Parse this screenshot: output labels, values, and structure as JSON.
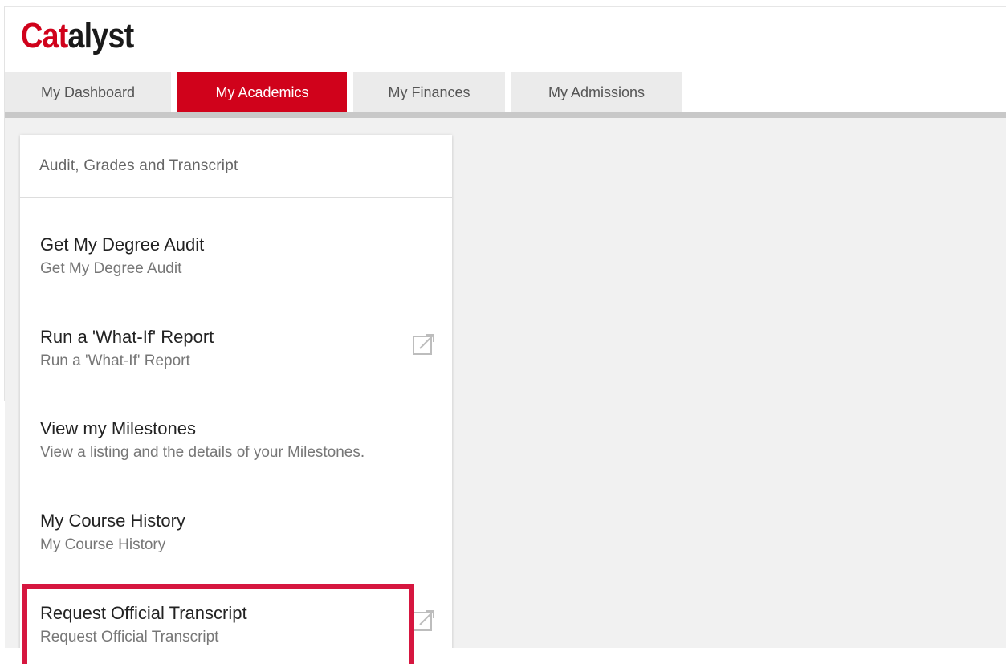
{
  "app": {
    "logo_part1": "Cat",
    "logo_part2": "alyst"
  },
  "tabs": [
    {
      "label": "My Dashboard",
      "active": false
    },
    {
      "label": "My Academics",
      "active": true
    },
    {
      "label": "My Finances",
      "active": false
    },
    {
      "label": "My Admissions",
      "active": false
    }
  ],
  "card": {
    "title": "Audit, Grades and Transcript",
    "items": [
      {
        "title": "Get My Degree Audit",
        "subtitle": "Get My Degree Audit",
        "icon": "none"
      },
      {
        "title": "Run a 'What-If' Report",
        "subtitle": "Run a 'What-If' Report",
        "icon": "external-link-icon"
      },
      {
        "title": "View my Milestones",
        "subtitle": "View a listing and the details of your Milestones.",
        "icon": "none"
      },
      {
        "title": "My Course History",
        "subtitle": "My Course History",
        "icon": "none"
      },
      {
        "title": "Request Official Transcript",
        "subtitle": "Request Official Transcript",
        "icon": "external-link-icon"
      }
    ]
  },
  "colors": {
    "brand_red": "#d0021b",
    "highlight_red": "#d6163f",
    "tab_inactive": "#ebebeb",
    "page_bg": "#f1f1f1"
  }
}
